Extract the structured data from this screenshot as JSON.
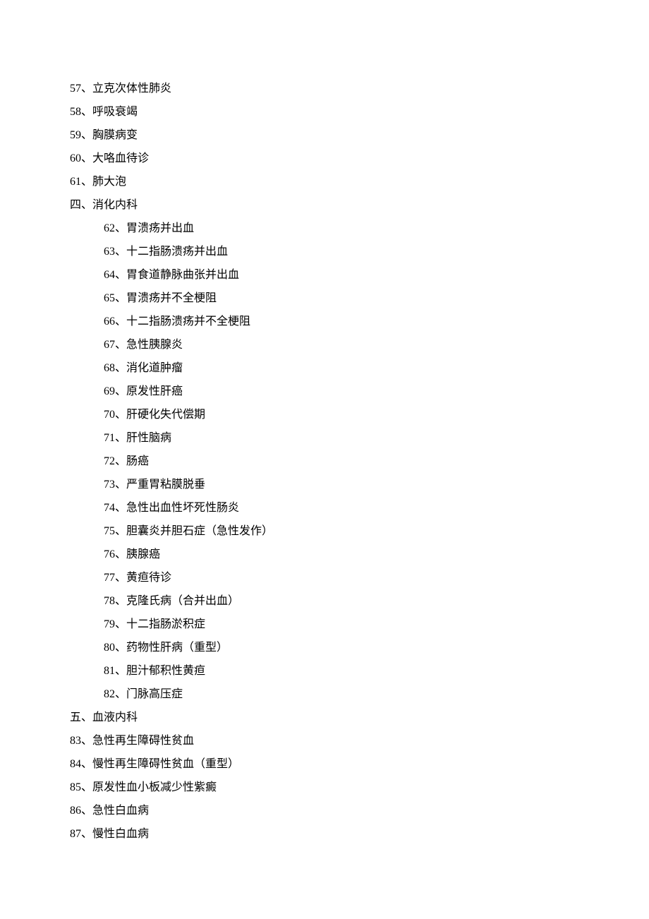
{
  "lines": [
    {
      "text": "57、立克次体性肺炎",
      "indent": false
    },
    {
      "text": "58、呼吸衰竭",
      "indent": false
    },
    {
      "text": "59、胸膜病变",
      "indent": false
    },
    {
      "text": "60、大咯血待诊",
      "indent": false
    },
    {
      "text": "61、肺大泡",
      "indent": false
    },
    {
      "text": "四、消化内科",
      "indent": false
    },
    {
      "text": "62、胃溃疡并出血",
      "indent": true
    },
    {
      "text": "63、十二指肠溃疡并出血",
      "indent": true
    },
    {
      "text": "64、胃食道静脉曲张并出血",
      "indent": true
    },
    {
      "text": "65、胃溃疡并不全梗阻",
      "indent": true
    },
    {
      "text": "66、十二指肠溃疡并不全梗阻",
      "indent": true
    },
    {
      "text": "67、急性胰腺炎",
      "indent": true
    },
    {
      "text": "68、消化道肿瘤",
      "indent": true
    },
    {
      "text": "69、原发性肝癌",
      "indent": true
    },
    {
      "text": "70、肝硬化失代偿期",
      "indent": true
    },
    {
      "text": "71、肝性脑病",
      "indent": true
    },
    {
      "text": "72、肠癌",
      "indent": true
    },
    {
      "text": "73、严重胃粘膜脱垂",
      "indent": true
    },
    {
      "text": "74、急性出血性坏死性肠炎",
      "indent": true
    },
    {
      "text": "75、胆囊炎并胆石症（急性发作）",
      "indent": true
    },
    {
      "text": "76、胰腺癌",
      "indent": true
    },
    {
      "text": "77、黄疸待诊",
      "indent": true
    },
    {
      "text": "78、克隆氏病（合并出血）",
      "indent": true
    },
    {
      "text": "79、十二指肠淤积症",
      "indent": true
    },
    {
      "text": "80、药物性肝病（重型）",
      "indent": true
    },
    {
      "text": "81、胆汁郁积性黄疸",
      "indent": true
    },
    {
      "text": "82、门脉高压症",
      "indent": true
    },
    {
      "text": "五、血液内科",
      "indent": false
    },
    {
      "text": "83、急性再生障碍性贫血",
      "indent": false
    },
    {
      "text": "84、慢性再生障碍性贫血（重型）",
      "indent": false
    },
    {
      "text": "85、原发性血小板减少性紫癜",
      "indent": false
    },
    {
      "text": "86、急性白血病",
      "indent": false
    },
    {
      "text": "87、慢性白血病",
      "indent": false
    }
  ]
}
